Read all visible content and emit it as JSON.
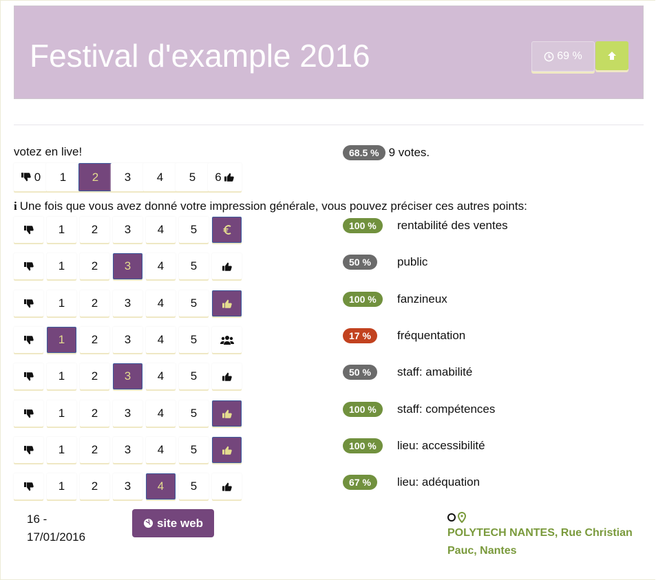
{
  "header": {
    "title": "Festival d'example 2016",
    "time_btn_label": "69 %",
    "up_icon": "arrow-up-icon",
    "clock_icon": "clock-icon"
  },
  "live_vote": {
    "label": "votez en live!",
    "options": [
      "0",
      "1",
      "2",
      "3",
      "4",
      "5",
      "6"
    ],
    "selected": "2"
  },
  "global": {
    "percent": "68.5 %",
    "votes": "9 votes."
  },
  "info_text": "Une fois que vous avez donné votre impression générale, vous pouvez préciser ces autres points:",
  "criteria": [
    {
      "pct": "100 %",
      "color": "g",
      "label": "rentabilité des ventes",
      "selected": "end",
      "end_icon": "euro-icon"
    },
    {
      "pct": "50 %",
      "color": "gr",
      "label": "public",
      "selected": "3",
      "end_icon": "thumbs-up-icon"
    },
    {
      "pct": "100 %",
      "color": "g",
      "label": "fanzineux",
      "selected": "end",
      "end_icon": "thumbs-up-icon"
    },
    {
      "pct": "17 %",
      "color": "r",
      "label": "fréquentation",
      "selected": "1",
      "end_icon": "users-icon"
    },
    {
      "pct": "50 %",
      "color": "gr",
      "label": "staff: amabilité",
      "selected": "3",
      "end_icon": "thumbs-up-icon"
    },
    {
      "pct": "100 %",
      "color": "g",
      "label": "staff: compétences",
      "selected": "end",
      "end_icon": "thumbs-up-icon"
    },
    {
      "pct": "100 %",
      "color": "g",
      "label": "lieu: accessibilité",
      "selected": "end",
      "end_icon": "thumbs-up-icon"
    },
    {
      "pct": "67 %",
      "color": "g",
      "label": "lieu: adéquation",
      "selected": "4",
      "end_icon": "thumbs-up-icon"
    }
  ],
  "footer": {
    "date_line1": "16 -",
    "date_line2": "17/01/2016",
    "site_label": "site web",
    "address": "POLYTECH NANTES, Rue Christian Pauc, Nantes"
  },
  "colors": {
    "header_bg": "#d2bcd5",
    "accent": "#74467c",
    "green": "#71913e",
    "red": "#c2421f",
    "grey": "#6b6b6b"
  }
}
